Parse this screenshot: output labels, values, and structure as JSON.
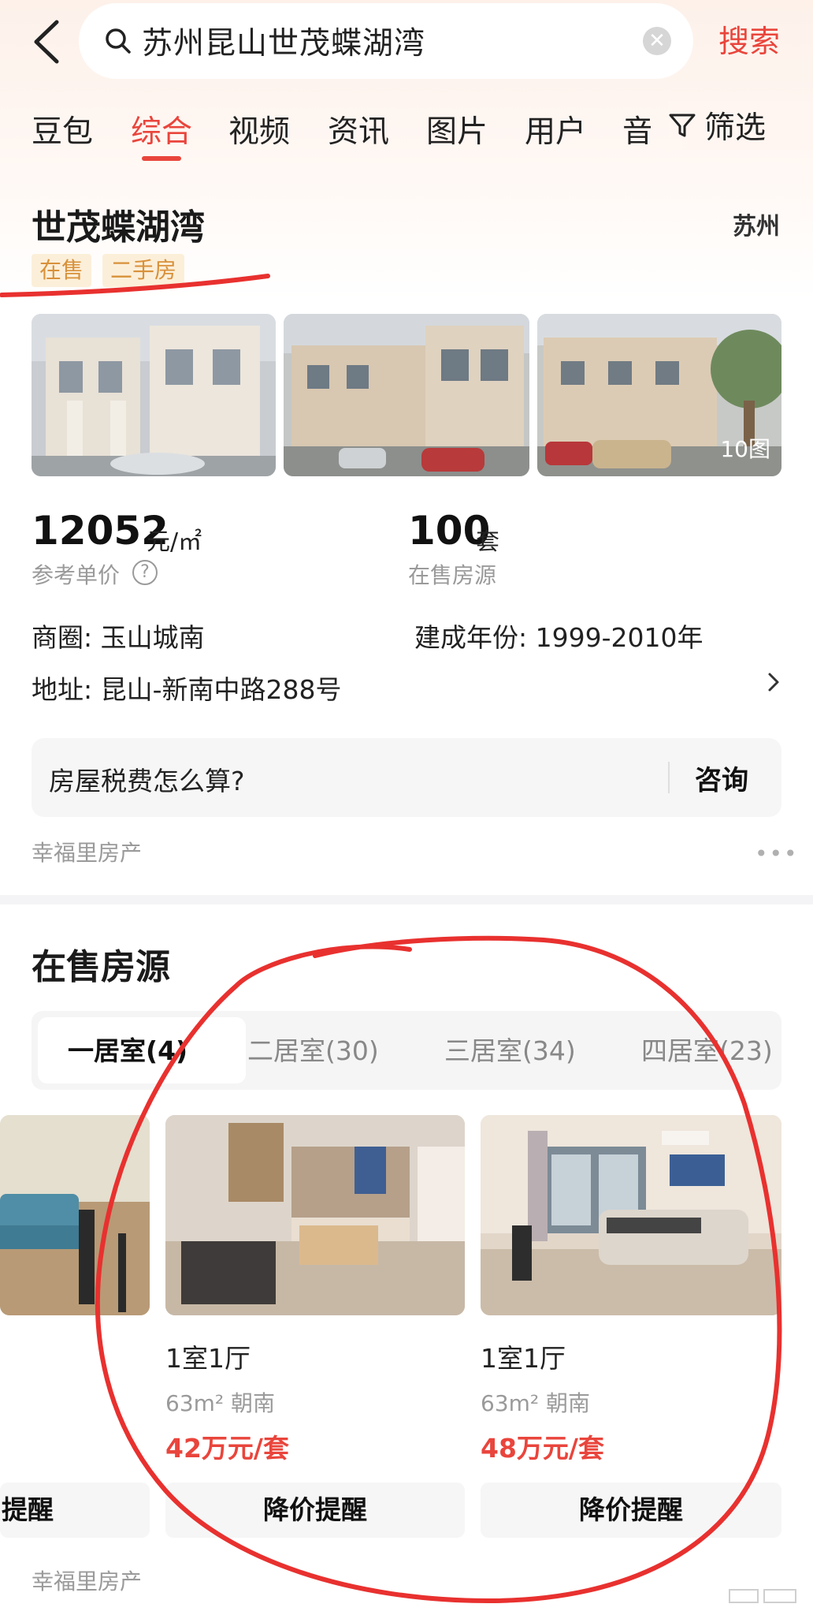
{
  "search": {
    "query": "苏州昆山世茂蝶湖湾",
    "button_label": "搜索"
  },
  "tabs": [
    {
      "label": "豆包"
    },
    {
      "label": "综合"
    },
    {
      "label": "视频"
    },
    {
      "label": "资讯"
    },
    {
      "label": "图片"
    },
    {
      "label": "用户"
    },
    {
      "label": "音乐"
    }
  ],
  "active_tab": "综合",
  "filter": {
    "label": "筛选"
  },
  "community": {
    "name": "世茂蝶湖湾",
    "city": "苏州",
    "tags": [
      "在售",
      "二手房"
    ],
    "photo_count_label": "10图",
    "unit_price": "12052",
    "unit_price_unit": "元/㎡",
    "unit_price_label": "参考单价",
    "listing_count": "100",
    "listing_count_unit": "套",
    "listing_count_label": "在售房源",
    "business_area": "商圈: 玉山城南",
    "build_year": "建成年份: 1999-2010年",
    "address": "地址: 昆山-新南中路288号"
  },
  "faq": {
    "question": "房屋税费怎么算?",
    "button_label": "咨询"
  },
  "source_label": "幸福里房产",
  "listings_section": {
    "title": "在售房源",
    "room_tabs": [
      "一居室(4)",
      "二居室(30)",
      "三居室(34)",
      "四居室(23)"
    ],
    "cards": [
      {
        "layout": "1室1厅",
        "meta": "63m² 朝南",
        "price": "42万元/套",
        "button": "降价提醒"
      },
      {
        "layout": "1室1厅",
        "meta": "63m² 朝南",
        "price": "48万元/套",
        "button": "降价提醒"
      }
    ],
    "partial_card_button": "提醒",
    "source_label": "幸福里房产"
  },
  "colors": {
    "accent": "#e9453c",
    "tag_text": "#d8913b",
    "tag_bg": "#fcefd9",
    "annotation": "#e8312f"
  },
  "icons": [
    "back-arrow-icon",
    "search-icon",
    "clear-icon",
    "filter-icon",
    "help-icon",
    "chevron-right-icon",
    "more-dots-icon"
  ]
}
